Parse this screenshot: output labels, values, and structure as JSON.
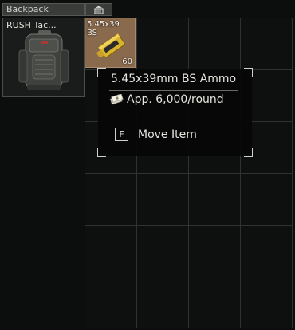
{
  "container": {
    "title": "Backpack"
  },
  "equipped": {
    "name": "RUSH Tac..."
  },
  "item": {
    "short_name": "5.45x39\nBS",
    "count": "60"
  },
  "tooltip": {
    "title": "5.45x39mm BS Ammo",
    "price": "App. 6,000/round",
    "action_key": "F",
    "action_label": "Move Item"
  },
  "colors": {
    "item_background": "#8a6a4d",
    "grid_line": "#2f3230",
    "panel": "#3a3c3a"
  }
}
